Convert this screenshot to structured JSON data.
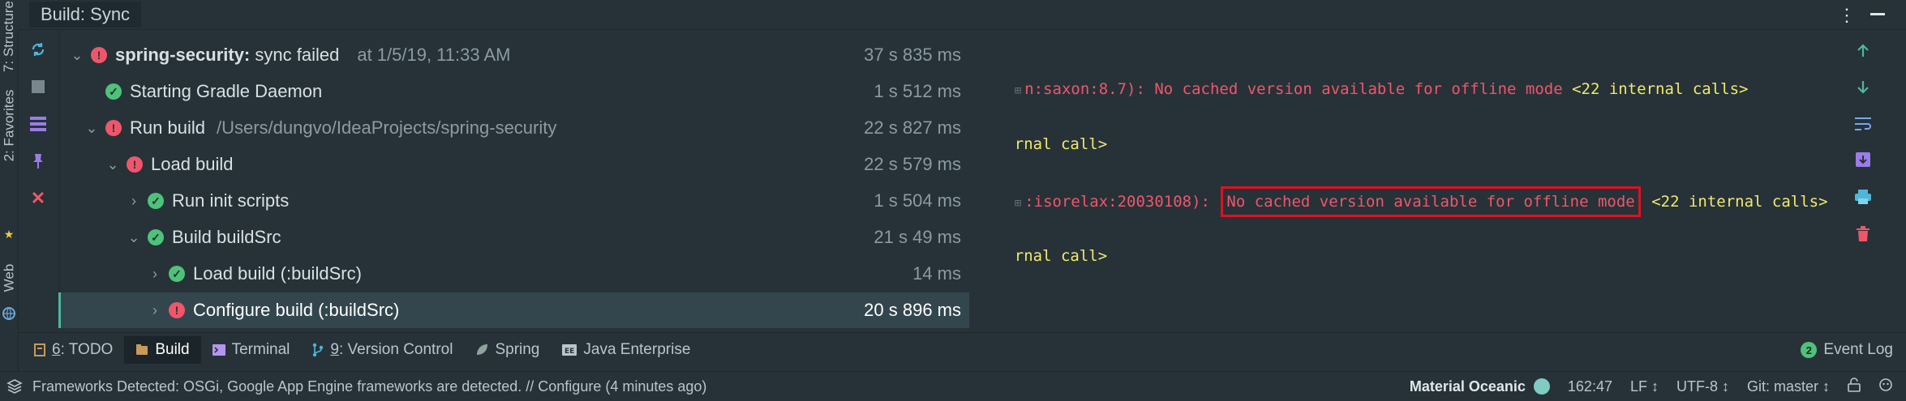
{
  "left_strip": {
    "structure_label": "7: Structure",
    "favorites_label": "2: Favorites",
    "web_label": "Web"
  },
  "header": {
    "tab_title": "Build: Sync"
  },
  "tree": {
    "rows": [
      {
        "label": "spring-security:",
        "suffix": " sync failed",
        "timestamp": "at 1/5/19, 11:33 AM",
        "duration": "37 s 835 ms",
        "status": "error",
        "indent": 0
      },
      {
        "label": "Starting Gradle Daemon",
        "duration": "1 s 512 ms",
        "status": "success",
        "indent": 1
      },
      {
        "label": "Run build",
        "path": "/Users/dungvo/IdeaProjects/spring-security",
        "duration": "22 s 827 ms",
        "status": "error",
        "indent": 1
      },
      {
        "label": "Load build",
        "duration": "22 s 579 ms",
        "status": "error",
        "indent": 2
      },
      {
        "label": "Run init scripts",
        "duration": "1 s 504 ms",
        "status": "success",
        "indent": 3
      },
      {
        "label": "Build buildSrc",
        "duration": "21 s 49 ms",
        "status": "success",
        "indent": 3
      },
      {
        "label": "Load build (:buildSrc)",
        "duration": "14 ms",
        "status": "success",
        "indent": 4
      },
      {
        "label": "Configure build (:buildSrc)",
        "duration": "20 s 896 ms",
        "status": "error",
        "indent": 4
      }
    ]
  },
  "console": {
    "line1_prefix": "n:saxon:8.7): No cached version available for offline mode ",
    "line1_link": "<22 internal calls>",
    "line2_link": "rnal call>",
    "line3_prefix": ":isorelax:20030108): ",
    "line3_highlight": "No cached version available for offline mode",
    "line3_link": " <22 internal calls>",
    "line4_link": "rnal call>"
  },
  "tool_tabs": {
    "todo_key": "6",
    "todo_rest": ": TODO",
    "build": "Build",
    "terminal": "Terminal",
    "vc_key": "9",
    "vc_rest": ": Version Control",
    "spring": "Spring",
    "java_ee": "Java Enterprise",
    "event_log": "Event Log",
    "event_count": "2"
  },
  "status_bar": {
    "message": "Frameworks Detected: OSGi, Google App Engine frameworks are detected. // Configure (4 minutes ago)",
    "theme": "Material Oceanic",
    "position": "162:47",
    "line_sep": "LF ↕",
    "encoding": "UTF-8 ↕",
    "git": "Git: master ↕"
  },
  "colors": {
    "background": "#263238",
    "error": "#f0566a",
    "success": "#4fc27a",
    "link": "#f2e86d",
    "highlight_border": "#e01020",
    "selection": "#33464e"
  }
}
